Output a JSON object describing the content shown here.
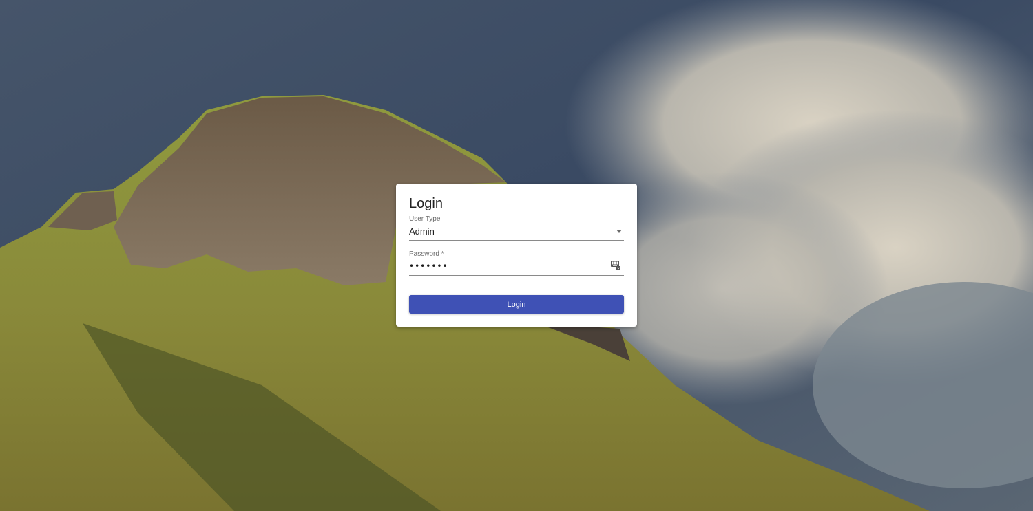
{
  "background": {
    "description_icon": "mountain-landscape-image"
  },
  "login": {
    "title": "Login",
    "user_type": {
      "label": "User Type",
      "value": "Admin"
    },
    "password": {
      "label": "Password *",
      "value": "•••••••"
    },
    "button_label": "Login"
  },
  "colors": {
    "primary": "#3f51b5",
    "card": "#ffffff"
  }
}
